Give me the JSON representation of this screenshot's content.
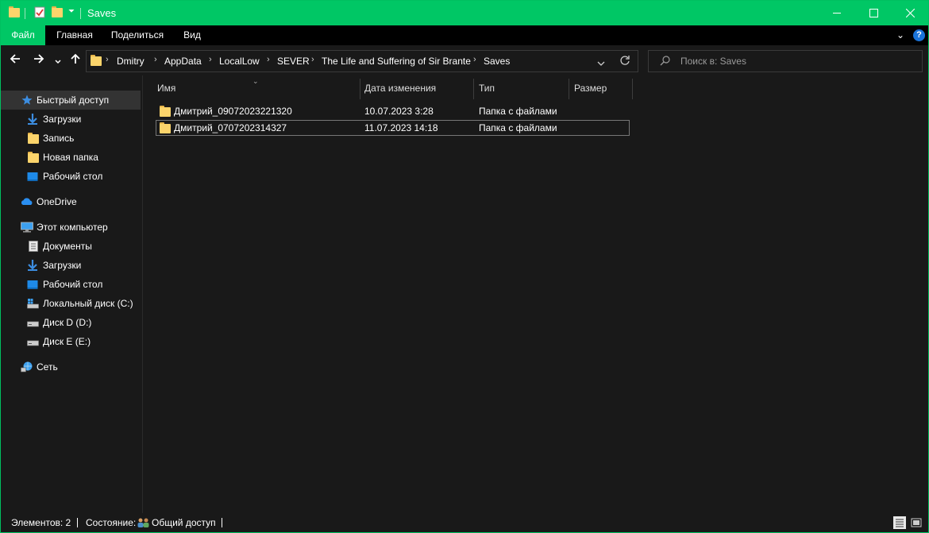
{
  "window": {
    "title": "Saves"
  },
  "ribbon": {
    "tabs": [
      "Файл",
      "Главная",
      "Поделиться",
      "Вид"
    ]
  },
  "address": {
    "crumbs": [
      "Dmitry",
      "AppData",
      "LocalLow",
      "SEVER",
      "The Life and Suffering of Sir Brante",
      "Saves"
    ]
  },
  "search": {
    "placeholder": "Поиск в: Saves"
  },
  "sidebar": {
    "items": [
      {
        "label": "Быстрый доступ",
        "icon": "star-icon"
      },
      {
        "label": "Загрузки",
        "icon": "download-icon"
      },
      {
        "label": "Запись",
        "icon": "folder-icon"
      },
      {
        "label": "Новая папка",
        "icon": "folder-icon"
      },
      {
        "label": "Рабочий стол",
        "icon": "desktop-icon"
      },
      {
        "label": "OneDrive",
        "icon": "cloud-icon"
      },
      {
        "label": "Этот компьютер",
        "icon": "computer-icon"
      },
      {
        "label": "Документы",
        "icon": "document-icon"
      },
      {
        "label": "Загрузки",
        "icon": "download-icon"
      },
      {
        "label": "Рабочий стол",
        "icon": "desktop-icon"
      },
      {
        "label": "Локальный диск (C:)",
        "icon": "system-drive-icon"
      },
      {
        "label": "Диск D (D:)",
        "icon": "drive-icon"
      },
      {
        "label": "Диск E (E:)",
        "icon": "drive-icon"
      },
      {
        "label": "Сеть",
        "icon": "network-icon"
      }
    ]
  },
  "columns": {
    "name": "Имя",
    "date": "Дата изменения",
    "type": "Тип",
    "size": "Размер"
  },
  "files": [
    {
      "name": "Дмитрий_09072023221320",
      "date": "10.07.2023 3:28",
      "type": "Папка с файлами",
      "size": ""
    },
    {
      "name": "Дмитрий_0707202314327",
      "date": "11.07.2023 14:18",
      "type": "Папка с файлами",
      "size": ""
    }
  ],
  "status": {
    "count": "Элементов: 2",
    "state_label": "Состояние:",
    "state_value": "Общий доступ"
  },
  "colors": {
    "accent": "#00c765",
    "background": "#191919",
    "folder": "#fcd46b"
  }
}
